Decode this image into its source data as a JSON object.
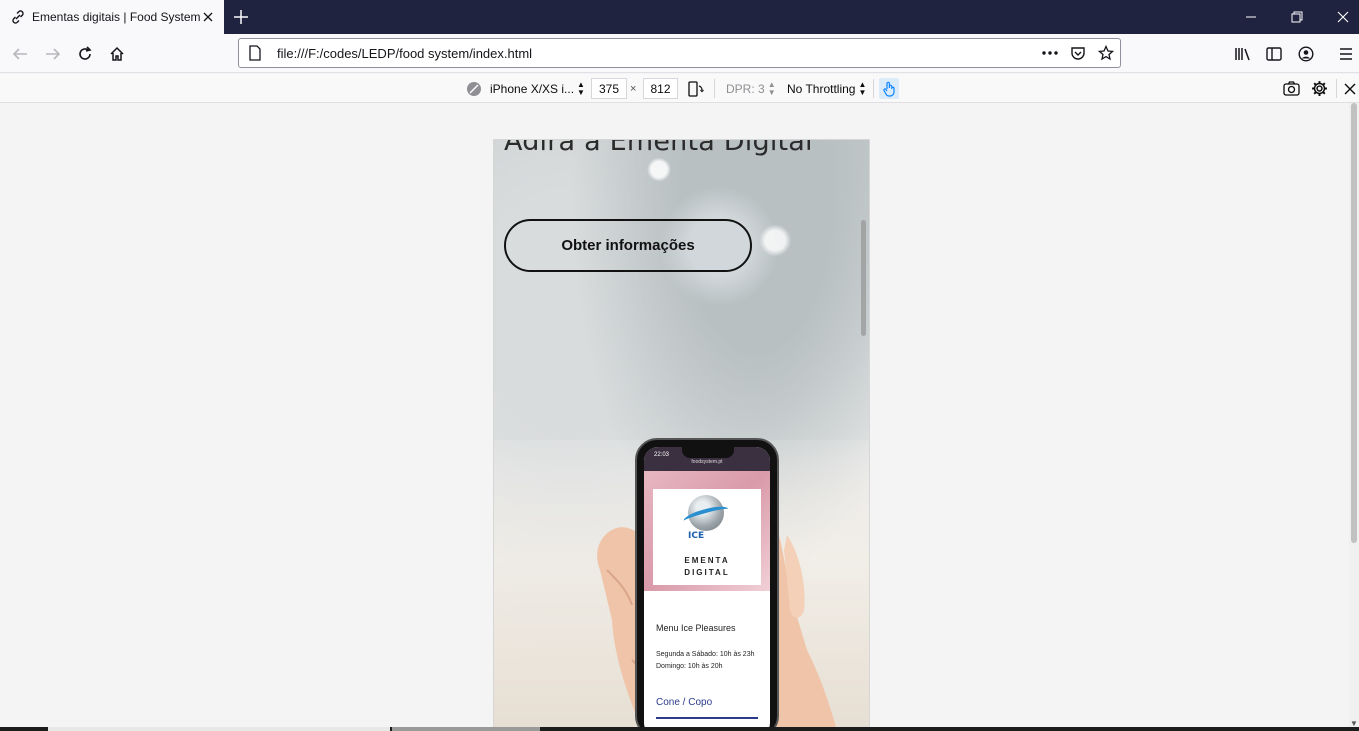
{
  "browser": {
    "tab_title": "Ementas digitais | Food System",
    "url": "file:///F:/codes/LEDP/food system/index.html"
  },
  "rdm": {
    "device": "iPhone X/XS i...",
    "width": "375",
    "times": "×",
    "height": "812",
    "dpr": "DPR: 3",
    "throttling": "No Throttling"
  },
  "page": {
    "hero_title": "Adira a Ementa Digital",
    "cta_label": "Obter informações"
  },
  "phone": {
    "time": "22:03",
    "address": "foodsystem.pt",
    "logo_text": "ICE",
    "banner_line1": "EMENTA",
    "banner_line2": "DIGITAL",
    "menu_title": "Menu Ice Pleasures",
    "hours_line1": "Segunda a Sábado: 10h às 23h",
    "hours_line2": "Domingo: 10h às 20h",
    "category": "Cone / Copo"
  },
  "icons": {
    "tab_favicon": "link-icon",
    "tab_close": "close-icon",
    "new_tab": "plus-icon",
    "back": "back-arrow-icon",
    "forward": "forward-arrow-icon",
    "reload": "reload-icon",
    "home": "home-icon",
    "page": "page-icon",
    "more": "more-dots-icon",
    "pocket": "pocket-icon",
    "bookmark": "star-icon",
    "library": "library-icon",
    "sidebar": "sidebar-icon",
    "account": "account-icon",
    "menu": "hamburger-icon",
    "screenshot": "camera-icon",
    "settings": "gear-icon",
    "close_rdm": "close-icon",
    "rotate": "rotate-device-icon",
    "touch": "touch-icon"
  }
}
